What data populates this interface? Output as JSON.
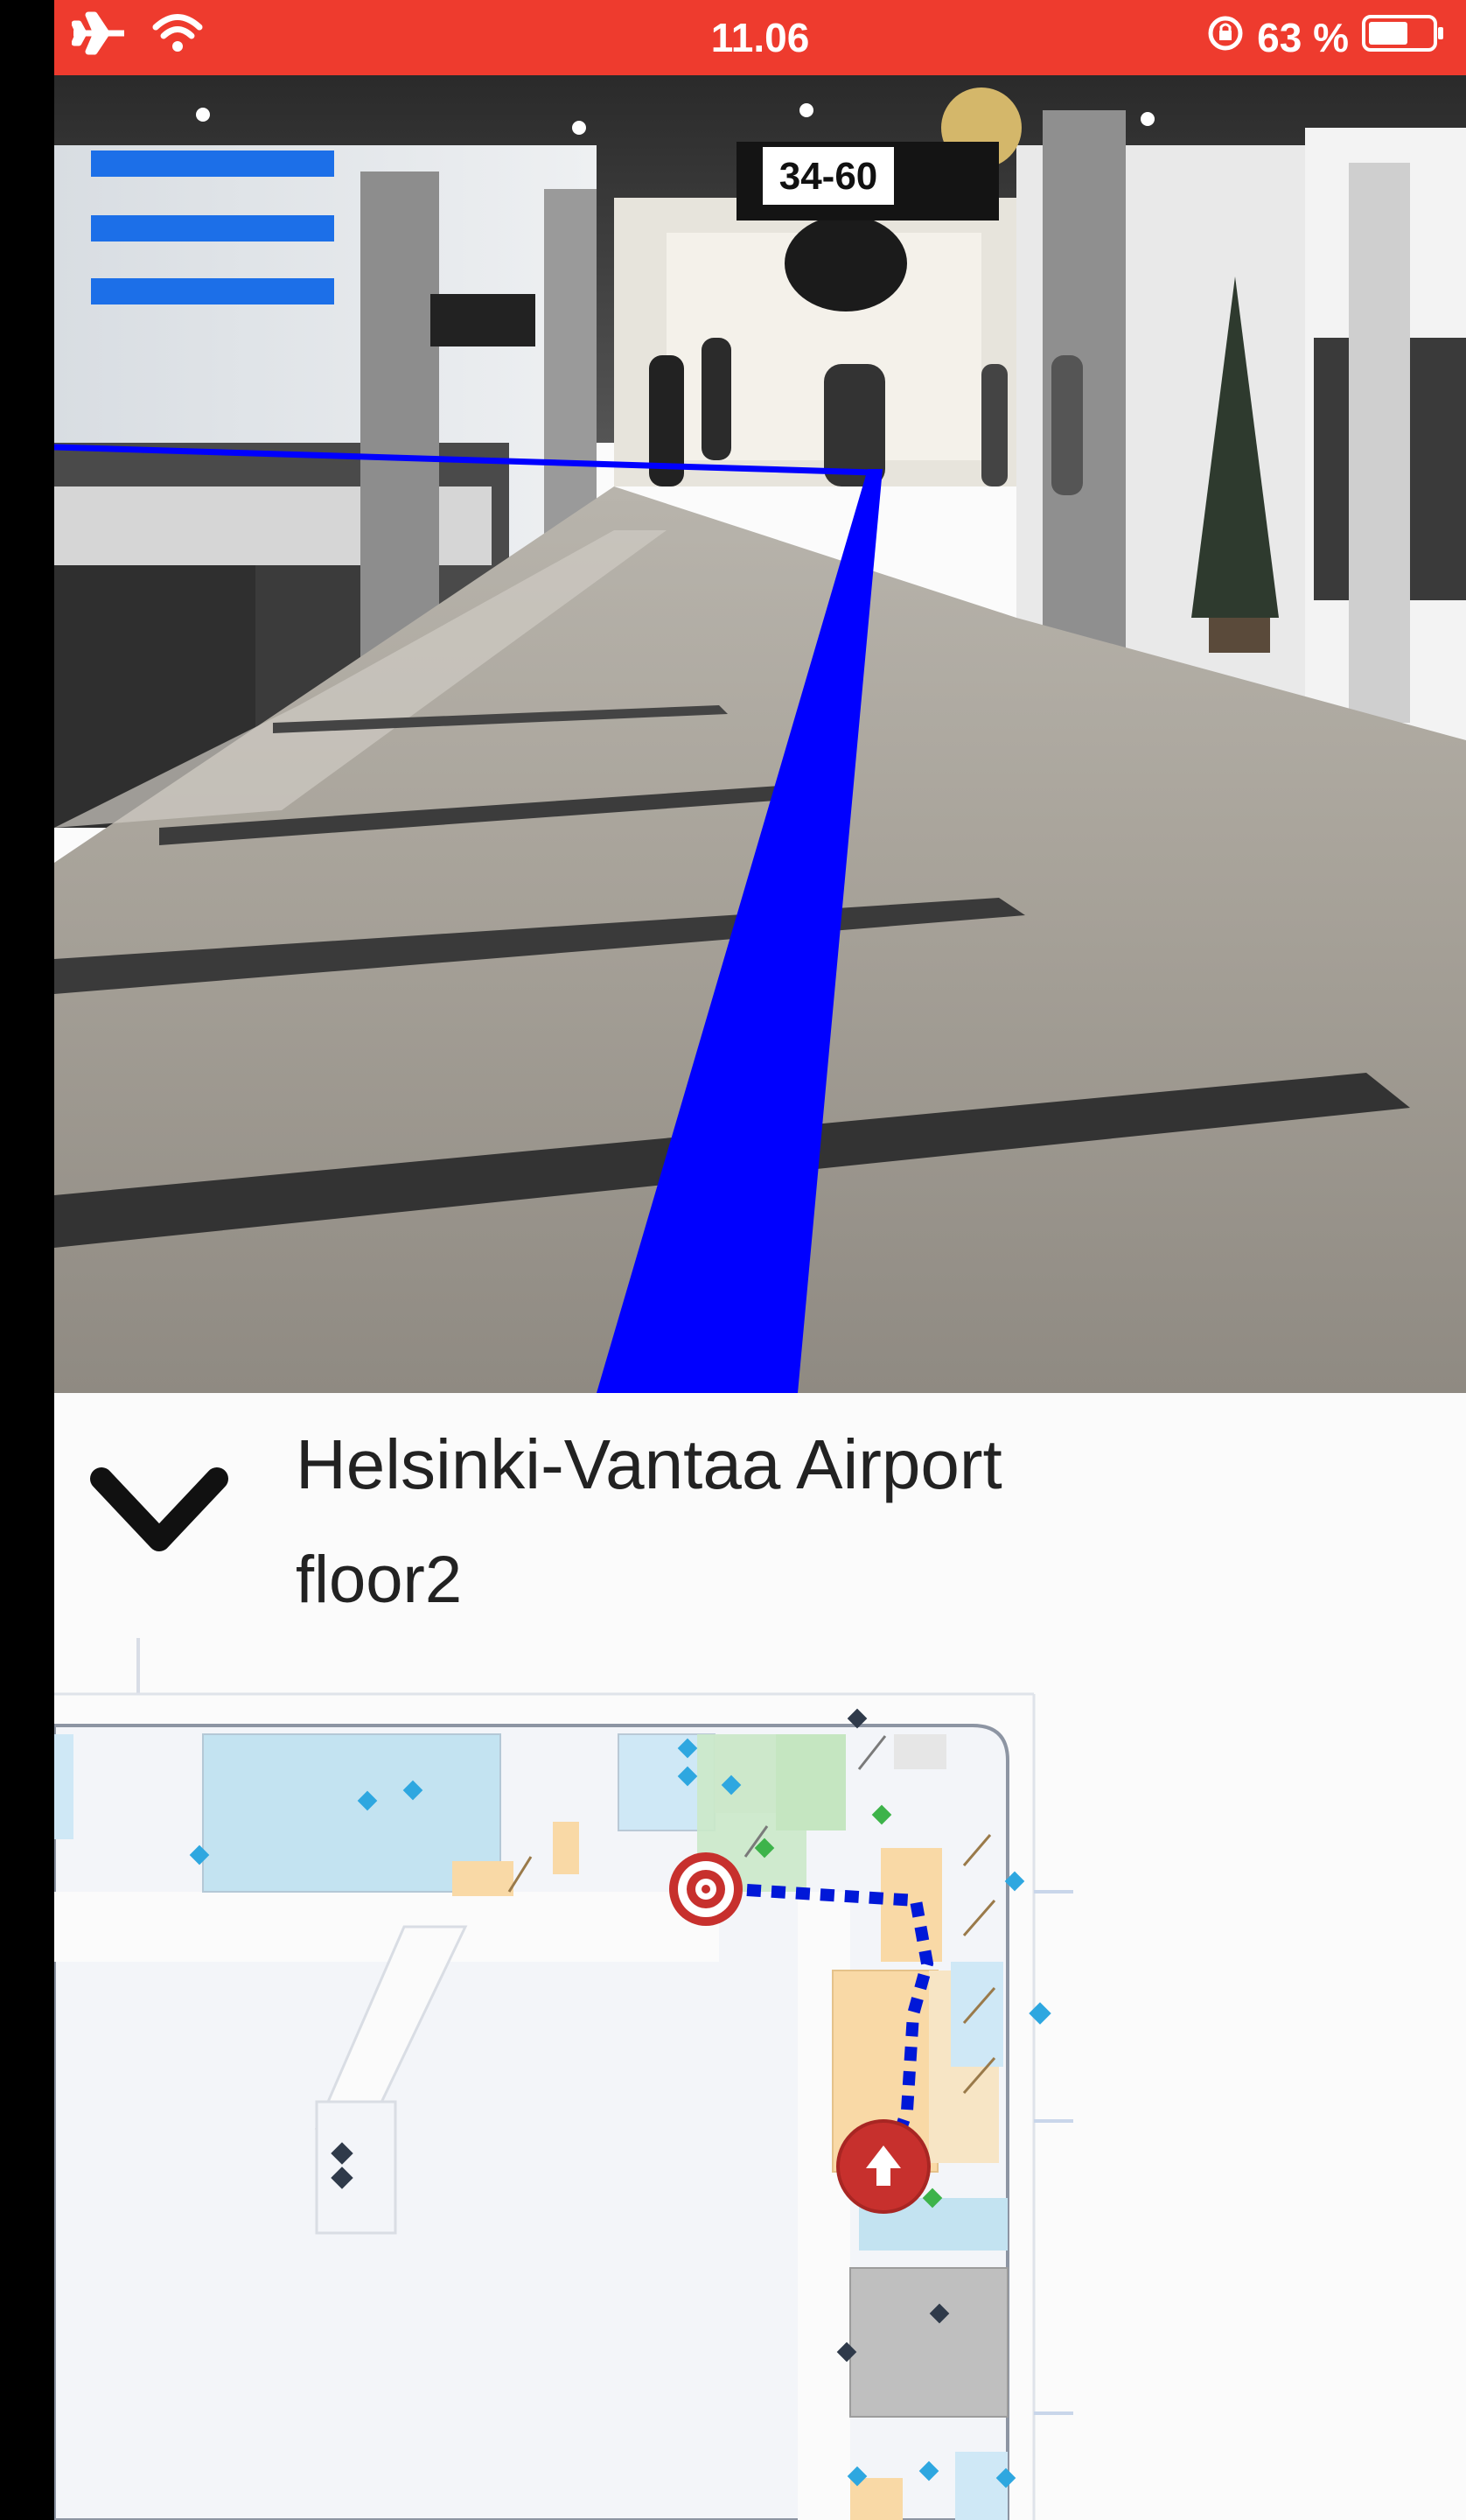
{
  "status_bar": {
    "time": "11.06",
    "battery_percent": "63 %",
    "battery_level": 0.63,
    "airplane_icon": "airplane-icon",
    "wifi_icon": "wifi-icon",
    "rotation_lock_icon": "rotation-lock-icon",
    "background_color": "#ee3b2e"
  },
  "camera": {
    "sign_text": "34-60",
    "route_color": "#0000ff"
  },
  "panel": {
    "collapse_icon": "chevron-down-icon",
    "venue_name": "Helsinki-Vantaa Airport",
    "floor_name": "floor2"
  },
  "map": {
    "destination_icon": "target-icon",
    "current_location_icon": "arrow-up-icon",
    "route_style": "dotted-blue"
  }
}
